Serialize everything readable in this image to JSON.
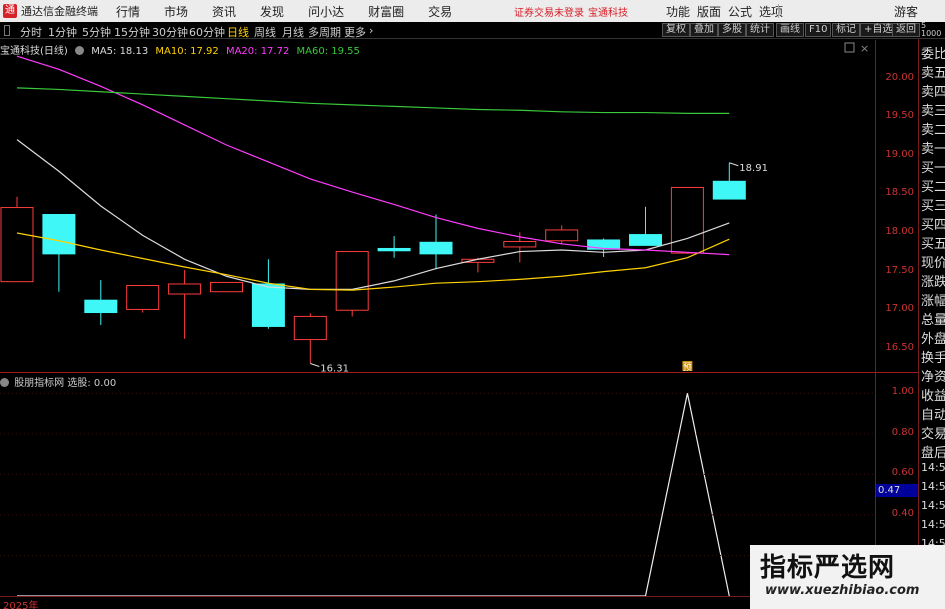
{
  "app": {
    "logo": "通",
    "title": "通达信金融终端"
  },
  "menu": {
    "items": [
      "行情",
      "市场",
      "资讯",
      "发现",
      "问小达",
      "财富圈",
      "交易"
    ],
    "login_status": "证券交易未登录",
    "stock": "宝通科技",
    "right_items": [
      "功能",
      "版面",
      "公式",
      "选项"
    ],
    "guest": "游客"
  },
  "toolbar": {
    "periods": [
      "分时",
      "1分钟",
      "5分钟",
      "15分钟",
      "30分钟",
      "60分钟",
      "日线",
      "周线",
      "月线",
      "多周期",
      "更多"
    ],
    "active_period": "日线",
    "buttons": [
      "复权",
      "叠加",
      "多股",
      "统计",
      "画线",
      "F10",
      "标记",
      "+自选",
      "返回"
    ]
  },
  "side_top": {
    "line1": "5",
    "line2": "1000"
  },
  "chart_info": {
    "stock_name": "宝通科技(日线)",
    "ma5": "MA5: 18.13",
    "ma10": "MA10: 17.92",
    "ma20": "MA20: 17.72",
    "ma60": "MA60: 19.55"
  },
  "price_axis": [
    "20.00",
    "19.50",
    "19.00",
    "18.50",
    "18.00",
    "17.50",
    "17.00",
    "16.50"
  ],
  "annotations": {
    "high": "18.91",
    "low": "16.31",
    "flag": "预"
  },
  "sidebar": [
    "委比",
    "卖五",
    "卖四",
    "卖三",
    "卖二",
    "卖一",
    "买一",
    "买二",
    "买三",
    "买四",
    "买五",
    "现价",
    "涨跌",
    "涨幅",
    "总量",
    "外盘",
    "换手",
    "净资",
    "收益",
    "自动",
    "交易",
    "盘后",
    "14:56",
    "14:56",
    "14:56",
    "14:56",
    "14:56",
    "14:56",
    "14:56"
  ],
  "indicator": {
    "name": "股朋指标网",
    "value": "选股: 0.00",
    "axis": [
      "1.00",
      "0.80",
      "0.60",
      "0.40",
      "0.20"
    ],
    "current": "0.47"
  },
  "bottom": {
    "year": "2025年"
  },
  "watermark": {
    "title": "指标严选网",
    "url": "www.xuezhibiao.com"
  },
  "colors": {
    "up": "#ff3c3c",
    "down": "#3ff7f7",
    "ma5": "#dcdcdc",
    "ma10": "#ffd200",
    "ma20": "#ff3cff",
    "ma60": "#39c93a",
    "grid": "#7a1b1b",
    "axis_text": "#cc3333"
  },
  "chart_data": {
    "type": "candlestick",
    "y_range": [
      16.2,
      20.5
    ],
    "candles": [
      {
        "open": 17.37,
        "close": 18.33,
        "high": 18.47,
        "low": 17.4
      },
      {
        "open": 18.24,
        "close": 17.73,
        "high": 18.21,
        "low": 17.24
      },
      {
        "open": 17.13,
        "close": 16.97,
        "high": 17.39,
        "low": 16.81
      },
      {
        "open": 17.01,
        "close": 17.32,
        "high": 17.32,
        "low": 16.97
      },
      {
        "open": 17.21,
        "close": 17.34,
        "high": 17.52,
        "low": 16.63
      },
      {
        "open": 17.24,
        "close": 17.36,
        "high": 17.36,
        "low": 17.24
      },
      {
        "open": 17.34,
        "close": 16.79,
        "high": 17.66,
        "low": 16.76
      },
      {
        "open": 16.62,
        "close": 16.92,
        "high": 16.96,
        "low": 16.31
      },
      {
        "open": 17.0,
        "close": 17.76,
        "high": 17.76,
        "low": 16.92
      },
      {
        "open": 17.8,
        "close": 17.77,
        "high": 17.96,
        "low": 17.68
      },
      {
        "open": 17.88,
        "close": 17.73,
        "high": 18.24,
        "low": 17.53
      },
      {
        "open": 17.62,
        "close": 17.66,
        "high": 17.68,
        "low": 17.49
      },
      {
        "open": 17.82,
        "close": 17.89,
        "high": 18.01,
        "low": 17.62
      },
      {
        "open": 17.9,
        "close": 18.04,
        "high": 18.1,
        "low": 17.85
      },
      {
        "open": 17.91,
        "close": 17.79,
        "high": 17.93,
        "low": 17.69
      },
      {
        "open": 17.98,
        "close": 17.84,
        "high": 18.34,
        "low": 17.84
      },
      {
        "open": 17.74,
        "close": 18.59,
        "high": 18.59,
        "low": 17.73
      },
      {
        "open": 18.67,
        "close": 18.44,
        "high": 18.91,
        "low": 18.44
      }
    ],
    "ma5": [
      19.21,
      18.8,
      18.35,
      17.97,
      17.66,
      17.44,
      17.3,
      17.27,
      17.27,
      17.38,
      17.54,
      17.66,
      17.76,
      17.78,
      17.75,
      17.78,
      17.93,
      18.13
    ],
    "ma10": [
      18.0,
      17.9,
      17.78,
      17.67,
      17.56,
      17.46,
      17.35,
      17.27,
      17.26,
      17.3,
      17.35,
      17.37,
      17.4,
      17.44,
      17.5,
      17.55,
      17.68,
      17.92
    ],
    "ma20": [
      20.29,
      20.12,
      19.9,
      19.66,
      19.4,
      19.14,
      18.92,
      18.7,
      18.53,
      18.37,
      18.2,
      18.06,
      17.95,
      17.86,
      17.8,
      17.78,
      17.75,
      17.72
    ],
    "ma60": [
      19.88,
      19.86,
      19.83,
      19.8,
      19.77,
      19.74,
      19.71,
      19.68,
      19.66,
      19.64,
      19.62,
      19.6,
      19.59,
      19.57,
      19.56,
      19.56,
      19.55,
      19.55
    ],
    "indicator": [
      0,
      0,
      0,
      0,
      0,
      0,
      0,
      0,
      0,
      0,
      0,
      0,
      0,
      0,
      0,
      0,
      1,
      0
    ],
    "indicator_range": [
      0,
      1.1
    ]
  }
}
